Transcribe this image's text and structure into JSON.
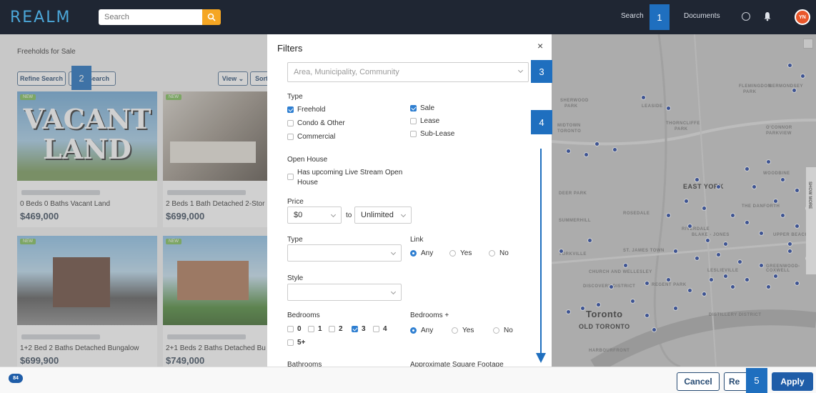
{
  "app": {
    "logo": "REALM"
  },
  "header": {
    "search_placeholder": "Search",
    "nav_search": "Search",
    "nav_documents": "Documents",
    "avatar_initials": "YN"
  },
  "callouts": [
    "1",
    "2",
    "3",
    "4",
    "5"
  ],
  "listing": {
    "title": "Freeholds for Sale",
    "refine_label": "Refine Search",
    "save_label": "Search",
    "view_label": "View",
    "sort_label": "Sort",
    "new_badge": "NEW",
    "cards": [
      {
        "info": "0 Beds 0 Baths Vacant Land",
        "price": "$469,000",
        "image_text": [
          "VACANT",
          "LAND"
        ]
      },
      {
        "info": "2 Beds 1 Bath Detached 2-Stor",
        "price": "$699,000"
      },
      {
        "info": "1+2 Bed 2 Baths Detached Bungalow",
        "price": "$699,900"
      },
      {
        "info": "2+1 Beds 2 Baths Detached Bu",
        "price": "$749,000"
      }
    ]
  },
  "filters": {
    "title": "Filters",
    "close": "×",
    "area_placeholder": "Area, Municipality, Community",
    "type_label": "Type",
    "type_options": [
      {
        "label": "Freehold",
        "checked": true
      },
      {
        "label": "Condo & Other",
        "checked": false
      },
      {
        "label": "Commercial",
        "checked": false
      }
    ],
    "tx_options": [
      {
        "label": "Sale",
        "checked": true
      },
      {
        "label": "Lease",
        "checked": false
      },
      {
        "label": "Sub-Lease",
        "checked": false
      }
    ],
    "open_house_label": "Open House",
    "open_house_option_line1": "Has upcoming Live Stream Open",
    "open_house_option_line2": "House",
    "price_label": "Price",
    "price_min": "$0",
    "price_to": "to",
    "price_max": "Unlimited",
    "type2_label": "Type",
    "link_label": "Link",
    "link_options": [
      "Any",
      "Yes",
      "No"
    ],
    "style_label": "Style",
    "bedrooms_label": "Bedrooms",
    "bedroom_options": [
      {
        "label": "0",
        "checked": false
      },
      {
        "label": "1",
        "checked": false
      },
      {
        "label": "2",
        "checked": false
      },
      {
        "label": "3",
        "checked": true
      },
      {
        "label": "4",
        "checked": false
      },
      {
        "label": "5+",
        "checked": false
      }
    ],
    "bedrooms_plus_label": "Bedrooms +",
    "bedrooms_plus_options": [
      "Any",
      "Yes",
      "No"
    ],
    "bathrooms_label": "Bathrooms",
    "sqft_label": "Approximate Square Footage"
  },
  "map": {
    "labels": [
      "SHERWOOD",
      "PARK",
      "LEASIDE",
      "MIDTOWN",
      "TORONTO",
      "THORNCLIFFE",
      "PARK",
      "O'CONNOR",
      "PARKVIEW",
      "FLEMINGDON",
      "PARK",
      "BERMONDSEY",
      "EAST YORK",
      "DEER PARK",
      "ROSEDALE",
      "SUMMERHILL",
      "THE DANFORTH",
      "RIVERDALE",
      "BLAKE - JONES",
      "UPPER BEACHES",
      "YORKVILLE",
      "ST. JAMES TOWN",
      "CHURCH AND WELLESLEY",
      "GREENWOOD-COXWELL",
      "DISCOVERY DISTRICT",
      "REGENT PARK",
      "LESLIEVILLE",
      "Toronto",
      "OLD TORONTO",
      "DISTILLERY DISTRICT",
      "HARBOURFRONT",
      "WOODBINE"
    ],
    "side_tab": "SHOW MORE"
  },
  "footer": {
    "count": "84",
    "cancel": "Cancel",
    "reset": "Re",
    "apply": "Apply"
  },
  "colors": {
    "accent": "#1f6fbf",
    "header": "#1f2633",
    "search_btn": "#f5a623",
    "apply": "#1f5da8"
  }
}
